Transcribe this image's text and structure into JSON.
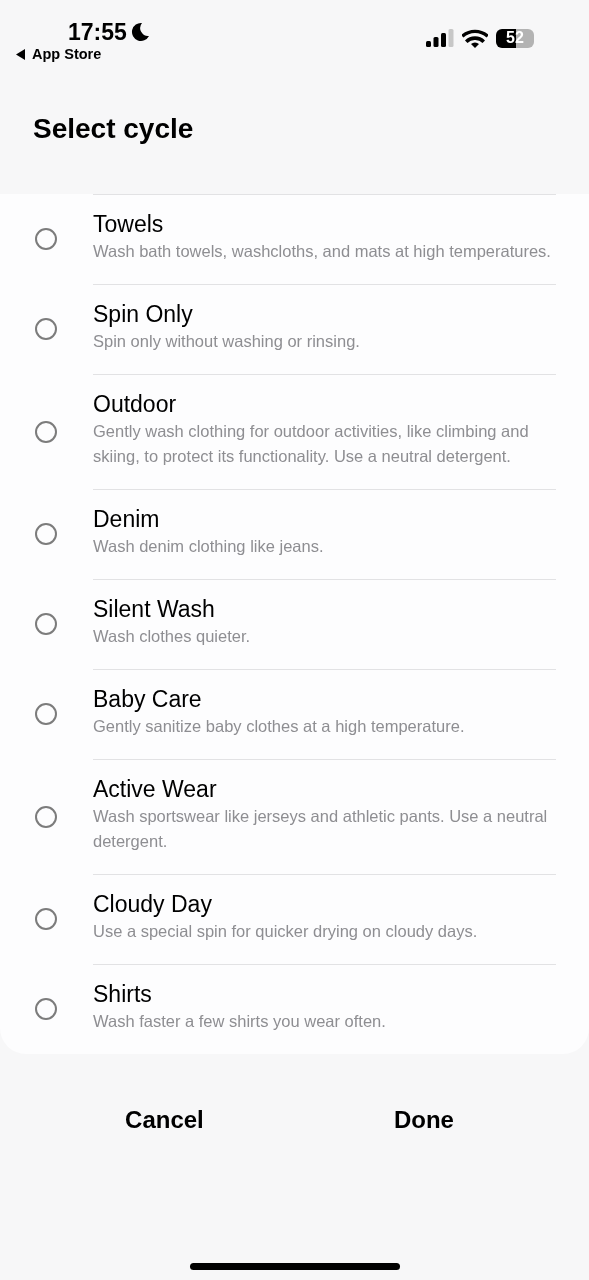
{
  "status_bar": {
    "time": "17:55",
    "back_label": "App Store",
    "battery": "52"
  },
  "title": "Select cycle",
  "options": [
    {
      "name": "Towels",
      "description": "Wash bath towels, washcloths, and mats at high temperatures.",
      "selected": false
    },
    {
      "name": "Spin Only",
      "description": "Spin only without washing or rinsing.",
      "selected": false
    },
    {
      "name": "Outdoor",
      "description": "Gently wash clothing for outdoor activities, like climbing and skiing, to protect its functionality. Use a neutral detergent.",
      "selected": false
    },
    {
      "name": "Denim",
      "description": "Wash denim clothing like jeans.",
      "selected": false
    },
    {
      "name": "Silent Wash",
      "description": "Wash clothes quieter.",
      "selected": false
    },
    {
      "name": "Baby Care",
      "description": "Gently sanitize baby clothes at a high temperature.",
      "selected": false
    },
    {
      "name": "Active Wear",
      "description": "Wash sportswear like jerseys and athletic pants. Use a neutral detergent.",
      "selected": false
    },
    {
      "name": "Cloudy Day",
      "description": "Use a special spin for quicker drying on cloudy days.",
      "selected": false
    },
    {
      "name": "Shirts",
      "description": "Wash faster a few shirts you wear often.",
      "selected": false
    }
  ],
  "buttons": [
    "Cancel",
    "Done"
  ]
}
